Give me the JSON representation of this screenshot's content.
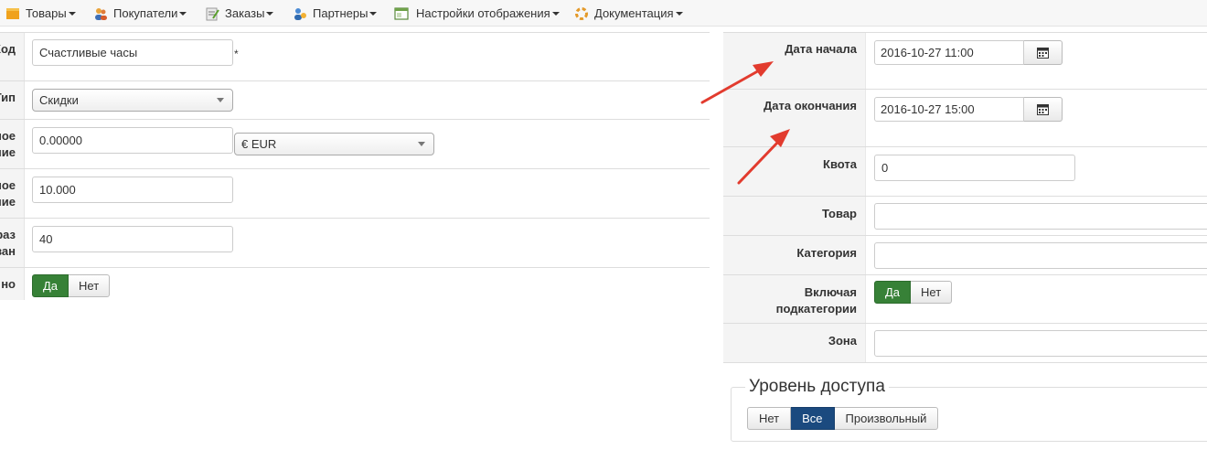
{
  "menu": [
    {
      "label": "Товары",
      "icon": "box-icon"
    },
    {
      "label": "Покупатели",
      "icon": "users-icon"
    },
    {
      "label": "Заказы",
      "icon": "orders-icon"
    },
    {
      "label": "Партнеры",
      "icon": "partners-icon"
    },
    {
      "label": "Настройки отображения",
      "icon": "display-settings-icon"
    },
    {
      "label": "Документация",
      "icon": "documentation-icon"
    }
  ],
  "left_form": {
    "code": {
      "label": "Код",
      "value": "Счастливые часы",
      "required_mark": "*"
    },
    "type": {
      "label": "Тип",
      "selected": "Скидки"
    },
    "value_row": {
      "label_line1": "ное",
      "label_line2": "ние",
      "value": "0.00000",
      "currency": "€ EUR"
    },
    "max_row": {
      "label_line1": "ное",
      "label_line2": "ние",
      "value": "10.000"
    },
    "uses_row": {
      "label_line1": "раз",
      "label_line2": "ван",
      "value": "40"
    },
    "enabled_row": {
      "label": "но",
      "yes": "Да",
      "no": "Нет"
    }
  },
  "right_form": {
    "start_date": {
      "label": "Дата начала",
      "value": "2016-10-27 11:00"
    },
    "end_date": {
      "label": "Дата окончания",
      "value": "2016-10-27 15:00"
    },
    "quota": {
      "label": "Квота",
      "value": "0"
    },
    "product": {
      "label": "Товар",
      "value": ""
    },
    "category": {
      "label": "Категория",
      "value": ""
    },
    "subcategories": {
      "label_line1": "Включая",
      "label_line2": "подкатегории",
      "yes": "Да",
      "no": "Нет"
    },
    "zone": {
      "label": "Зона",
      "value": ""
    }
  },
  "access_level": {
    "legend": "Уровень доступа",
    "options": [
      "Нет",
      "Все",
      "Произвольный"
    ],
    "selected": "Все"
  },
  "colors": {
    "active_green": "#378137",
    "active_blue": "#1b4a7f",
    "arrow_red": "#e23b2e"
  }
}
